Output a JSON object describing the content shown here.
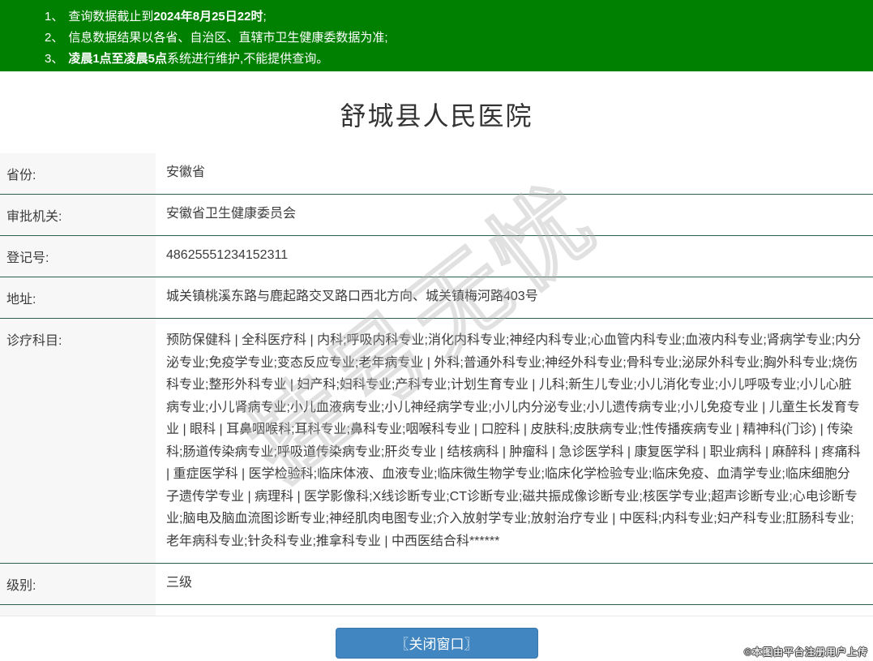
{
  "notice_bar": {
    "bg_color": "#008000",
    "items": [
      {
        "num": "1、",
        "pre": "查询数据截止到",
        "bold": "2024年8月25日22时",
        "post": ";"
      },
      {
        "num": "2、",
        "pre": "信息数据结果以各省、自治区、直辖市卫生健康委数据为准;",
        "bold": "",
        "post": ""
      },
      {
        "num": "3、",
        "pre": "",
        "bold": "凌晨1点至凌晨5点",
        "post": "系统进行维护,不能提供查询。"
      }
    ]
  },
  "title": "舒城县人民医院",
  "info_table": {
    "rows": [
      {
        "label": "省份:",
        "value": "安徽省"
      },
      {
        "label": "审批机关:",
        "value": "安徽省卫生健康委员会"
      },
      {
        "label": "登记号:",
        "value": "48625551234152311"
      },
      {
        "label": "地址:",
        "value": "城关镇桃溪东路与鹿起路交叉路口西北方向、城关镇梅河路403号"
      },
      {
        "label": "诊疗科目:",
        "value": "预防保健科 | 全科医疗科 | 内科;呼吸内科专业;消化内科专业;神经内科专业;心血管内科专业;血液内科专业;肾病学专业;内分泌专业;免疫学专业;变态反应专业;老年病专业 | 外科;普通外科专业;神经外科专业;骨科专业;泌尿外科专业;胸外科专业;烧伤科专业;整形外科专业 | 妇产科;妇科专业;产科专业;计划生育专业 | 儿科;新生儿专业;小儿消化专业;小儿呼吸专业;小儿心脏病专业;小儿肾病专业;小儿血液病专业;小儿神经病学专业;小儿内分泌专业;小儿遗传病专业;小儿免疫专业 | 儿童生长发育专业 | 眼科 | 耳鼻咽喉科;耳科专业;鼻科专业;咽喉科专业 | 口腔科 | 皮肤科;皮肤病专业;性传播疾病专业 | 精神科(门诊) | 传染科;肠道传染病专业;呼吸道传染病专业;肝炎专业 | 结核病科 | 肿瘤科 | 急诊医学科 | 康复医学科 | 职业病科 | 麻醉科 | 疼痛科 | 重症医学科 | 医学检验科;临床体液、血液专业;临床微生物学专业;临床化学检验专业;临床免疫、血清学专业;临床细胞分子遗传学专业 | 病理科 | 医学影像科;X线诊断专业;CT诊断专业;磁共振成像诊断专业;核医学专业;超声诊断专业;心电诊断专业;脑电及脑血流图诊断专业;神经肌肉电图专业;介入放射学专业;放射治疗专业 | 中医科;内科专业;妇产科专业;肛肠科专业;老年病科专业;针灸科专业;推拿科专业 | 中西医结合科******"
      },
      {
        "label": "级别:",
        "value": "三级"
      }
    ]
  },
  "close_button": {
    "label": "〖关闭窗口〗",
    "bg_color": "#4186c0"
  },
  "watermarks": {
    "diagonal_text": "挂号无忧",
    "corner_text": "©本图由平台注册用户上传"
  },
  "colors": {
    "header_green": "#008000",
    "row_divider_green": "#2e5e52",
    "label_cell_bg": "#f7f7f7",
    "button_blue": "#4186c0",
    "text_dark": "#3c3c3c"
  }
}
